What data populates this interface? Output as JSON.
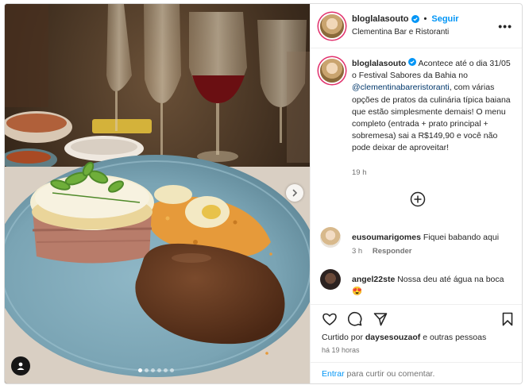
{
  "header": {
    "username": "bloglalasouto",
    "separator": "•",
    "follow_label": "Seguir",
    "location": "Clementina Bar e Ristoranti"
  },
  "caption": {
    "username": "bloglalasouto",
    "text_part1": "Acontece até o dia 31/05 o Festival Sabores da Bahia no ",
    "mention": "@clementinabareristoranti",
    "text_part2": ", com várias opções de pratos da culinária típica baiana que estão simplesmente demais! O menu completo (entrada + prato principal + sobremesa) sai a R$149,90 e você não pode deixar de aproveitar!",
    "time": "19 h"
  },
  "comments": [
    {
      "username": "eusoumarigomes",
      "text": "Fiquei babando aqui",
      "time": "3 h",
      "reply_label": "Responder"
    },
    {
      "username": "angel22ste",
      "text": "Nossa deu até água na boca",
      "emoji": "😍"
    }
  ],
  "likes": {
    "prefix": "Curtido por ",
    "user": "daysesouzaof",
    "suffix": " e outras pessoas"
  },
  "post_age": "há 19 horas",
  "comment_input": {
    "enter_label": "Entrar",
    "rest": " para curtir ou comentar."
  },
  "carousel": {
    "total": 6,
    "current": 1
  },
  "colors": {
    "accent": "#0095f6",
    "text": "#262626",
    "muted": "#737373",
    "plate": "#7fa8b8"
  }
}
